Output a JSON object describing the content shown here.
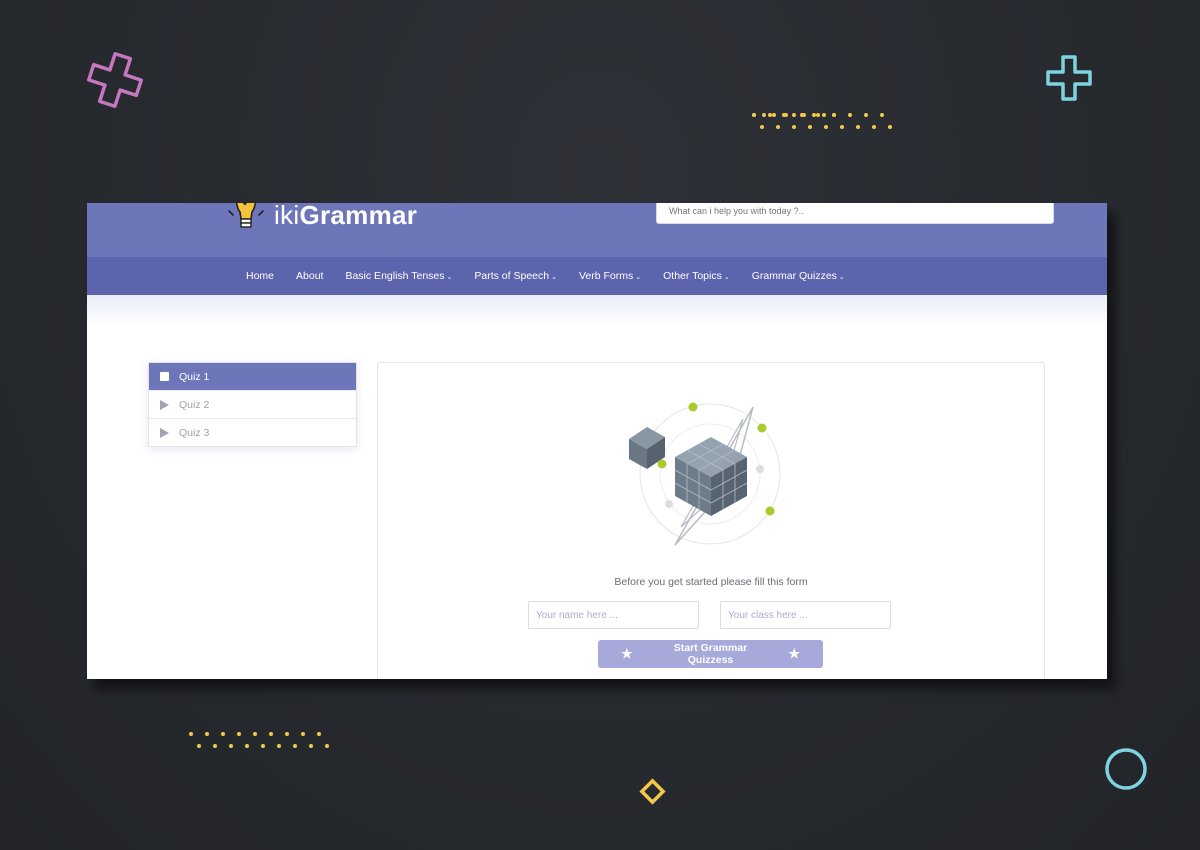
{
  "header": {
    "logo_prefix": "iki",
    "logo_main": "Grammar",
    "search_placeholder": "What can i help you with today ?.."
  },
  "nav": {
    "items": [
      {
        "label": "Home",
        "has_dropdown": false
      },
      {
        "label": "About",
        "has_dropdown": false
      },
      {
        "label": "Basic English Tenses",
        "has_dropdown": true
      },
      {
        "label": "Parts of Speech",
        "has_dropdown": true
      },
      {
        "label": "Verb Forms",
        "has_dropdown": true
      },
      {
        "label": "Other Topics",
        "has_dropdown": true
      },
      {
        "label": "Grammar Quizzes",
        "has_dropdown": true
      }
    ],
    "caret": "⌄"
  },
  "quiz_list": {
    "items": [
      {
        "label": "Quiz 1",
        "active": true
      },
      {
        "label": "Quiz 2",
        "active": false
      },
      {
        "label": "Quiz 3",
        "active": false
      }
    ]
  },
  "form": {
    "intro_text": "Before you get started please fill this form",
    "name_placeholder": "Your name here ...",
    "class_placeholder": "Your class here ...",
    "start_button_label": "Start Grammar Quizzess",
    "button_icon": "star-icon"
  },
  "colors": {
    "brand_primary": "#6e76ba",
    "nav_bar": "#5c64ad",
    "button": "#a6a9d9",
    "background": "#2a2d33",
    "accent_dots": "#f2c84b",
    "accent_pink": "#c776c0",
    "accent_cyan": "#7fd3df",
    "illustration_green": "#a8cc2c"
  }
}
